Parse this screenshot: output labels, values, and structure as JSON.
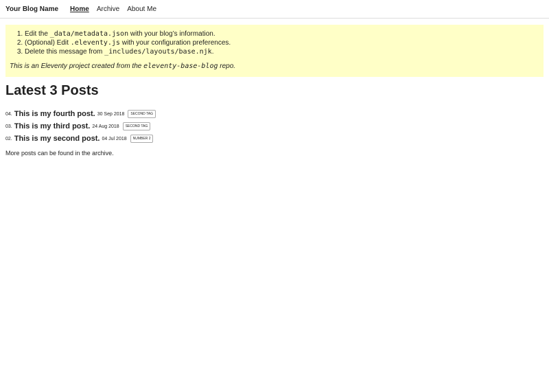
{
  "header": {
    "site_title": "Your Blog Name",
    "nav": [
      {
        "label": "Home",
        "active": true
      },
      {
        "label": "Archive"
      },
      {
        "label": "About Me"
      }
    ]
  },
  "warning": {
    "steps": [
      {
        "pre": "Edit the ",
        "code": "_data/metadata.json",
        "post": " with your blog’s information."
      },
      {
        "pre": "(Optional) Edit ",
        "code": ".eleventy.js",
        "mid": " with your ",
        "link": "configuration preferences",
        "post": "."
      },
      {
        "pre": "Delete this message from ",
        "code": "_includes/layouts/base.njk",
        "post": "."
      }
    ],
    "note_pre": "This is an ",
    "note_link1": "Eleventy project",
    "note_mid": " created from the ",
    "note_code": "eleventy-base-blog",
    "note_link2": " repo",
    "note_post": "."
  },
  "main": {
    "heading": "Latest 3 Posts",
    "posts": [
      {
        "num": "04.",
        "title": "This is my fourth post.",
        "date": "30 Sep 2018",
        "tag": "second tag"
      },
      {
        "num": "03.",
        "title": "This is my third post.",
        "date": "24 Aug 2018",
        "tag": "second tag"
      },
      {
        "num": "02.",
        "title": "This is my second post.",
        "date": "04 Jul 2018",
        "tag": "number 2"
      }
    ],
    "more_pre": "More posts can be found in ",
    "more_link": "the archive",
    "more_post": "."
  }
}
